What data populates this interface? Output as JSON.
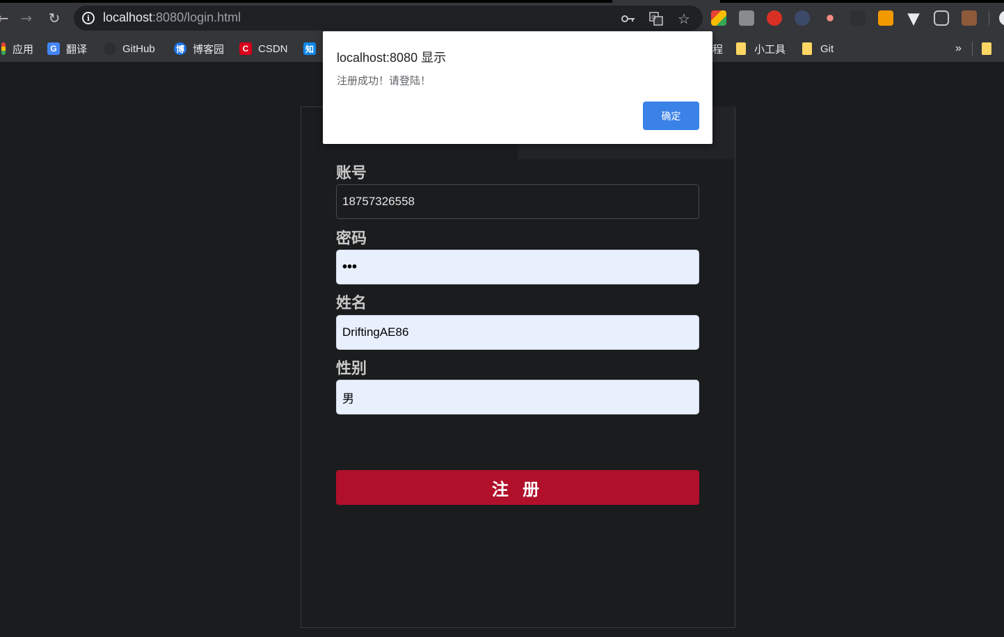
{
  "browser": {
    "url_host": "localhost",
    "url_rest": ":8080/login.html",
    "bookmarks": [
      {
        "label": "应用"
      },
      {
        "label": "翻译"
      },
      {
        "label": "GitHub"
      },
      {
        "label": "博客园"
      },
      {
        "label": "CSDN"
      },
      {
        "label": "知"
      },
      {
        "label": "程"
      },
      {
        "label": "小工具"
      },
      {
        "label": "Git"
      }
    ],
    "overflow_label": "»"
  },
  "dialog": {
    "title": "localhost:8080 显示",
    "message": "注册成功！请登陆！",
    "ok_label": "确定"
  },
  "form": {
    "account_label": "账号",
    "account_value": "18757326558",
    "password_label": "密码",
    "password_value": "•••",
    "name_label": "姓名",
    "name_value": "DriftingAE86",
    "gender_label": "性别",
    "gender_value": "男",
    "submit_label": "注 册"
  },
  "colors": {
    "page_bg": "#1b1c1e",
    "submit_bg": "#b0102a",
    "autofill_bg": "#e8f0fe",
    "dialog_button": "#3b82e8"
  }
}
